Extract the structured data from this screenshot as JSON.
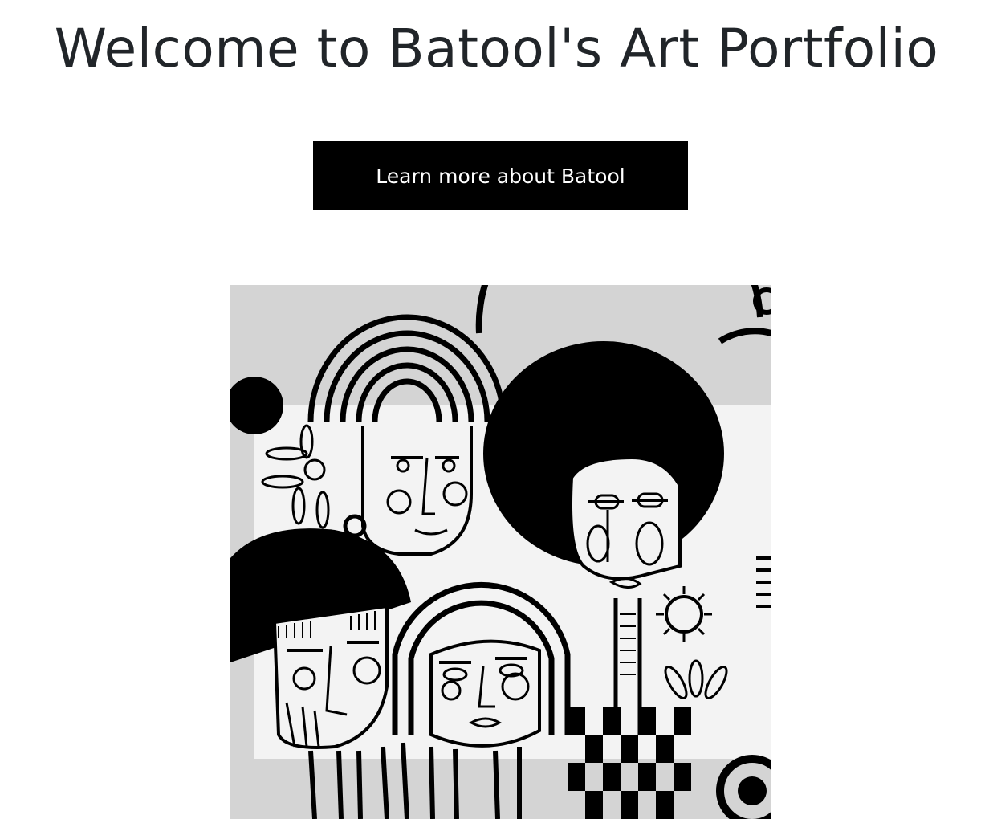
{
  "hero": {
    "title": "Welcome to Batool's Art Portfolio",
    "cta_label": "Learn more about Batool"
  },
  "artwork": {
    "description": "black-and-white-line-art-faces-painting",
    "icon": "artwork-image",
    "colors": {
      "background": "#d6d6d6",
      "canvas": "#f4f4f4",
      "ink": "#000000"
    }
  },
  "theme": {
    "title_color": "#212529",
    "button_bg": "#000000",
    "button_text": "#ffffff"
  }
}
